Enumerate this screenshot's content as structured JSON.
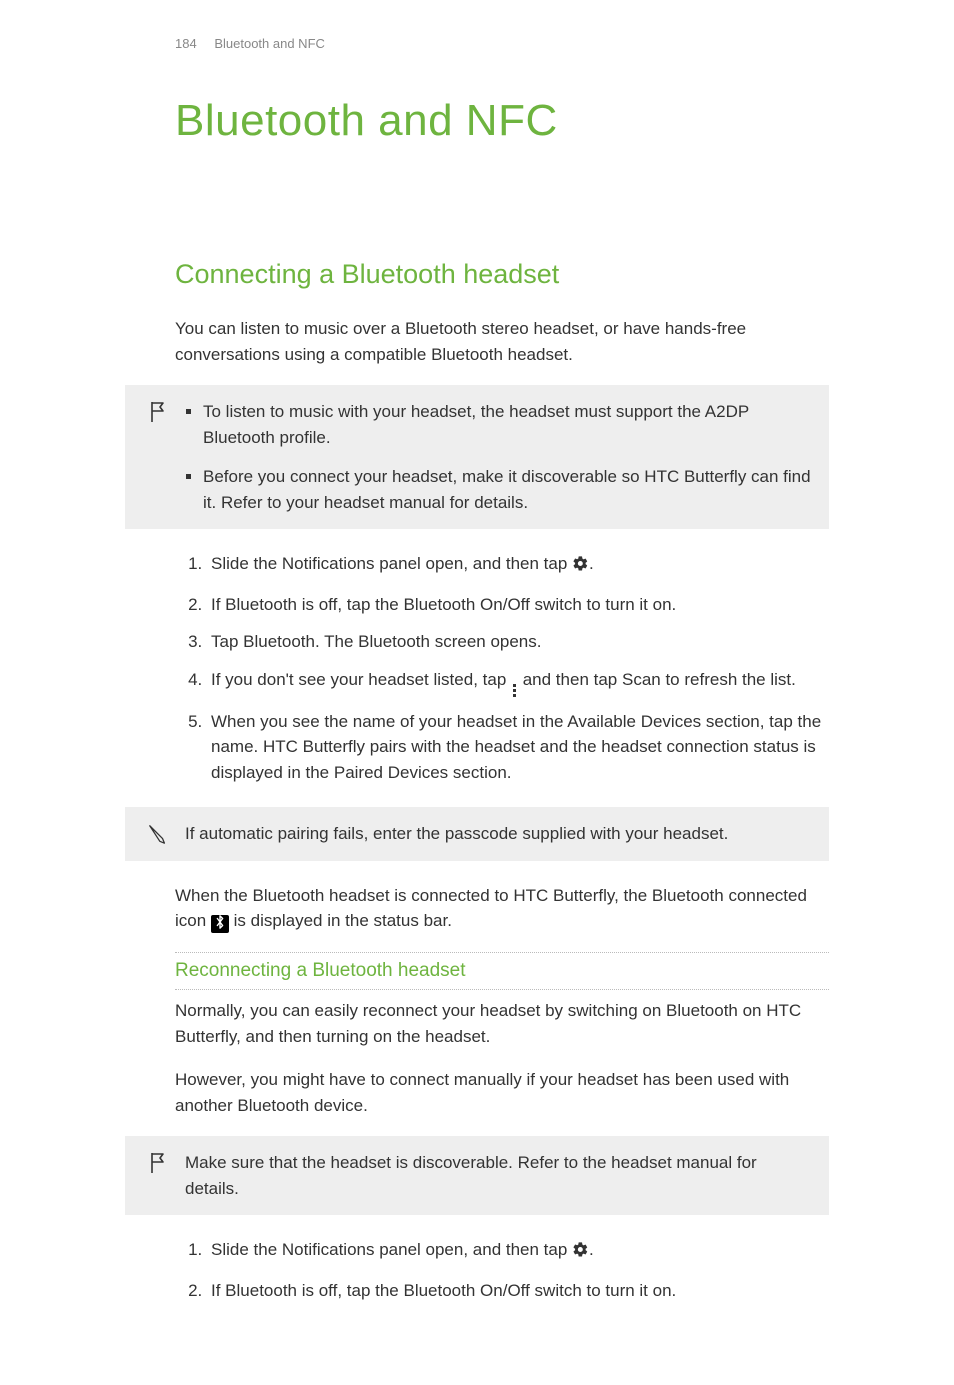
{
  "header": {
    "page_number": "184",
    "running_title": "Bluetooth and NFC"
  },
  "chapter_title": "Bluetooth and NFC",
  "section1": {
    "title": "Connecting a Bluetooth headset",
    "intro": "You can listen to music over a Bluetooth stereo headset, or have hands-free conversations using a compatible Bluetooth headset.",
    "req_note": {
      "items": [
        "To listen to music with your headset, the headset must support the A2DP Bluetooth profile.",
        "Before you connect your headset, make it discoverable so HTC Butterfly can find it. Refer to your headset manual for details."
      ]
    },
    "steps": {
      "s1a": "Slide the Notifications panel open, and then tap ",
      "s1b": ".",
      "s2a": "If Bluetooth is off, tap the Bluetooth ",
      "s2_onoff": "On/Off",
      "s2b": " switch to turn it on.",
      "s3a": "Tap ",
      "s3_bt": "Bluetooth",
      "s3b": ". The Bluetooth screen opens.",
      "s4a": "If you don't see your headset listed, tap ",
      "s4b": " and then tap ",
      "s4_scan": "Scan",
      "s4c": " to refresh the list.",
      "s5": "When you see the name of your headset in the Available Devices section, tap the name. HTC Butterfly pairs with the headset and the headset connection status is displayed in the Paired Devices section."
    },
    "tip_note": "If automatic pairing fails, enter the passcode supplied with your headset.",
    "after_a": "When the Bluetooth headset is connected to HTC Butterfly, the Bluetooth connected icon ",
    "after_b": " is displayed in the status bar."
  },
  "section2": {
    "title": "Reconnecting a Bluetooth headset",
    "p1": "Normally, you can easily reconnect your headset by switching on Bluetooth on HTC Butterfly, and then turning on the headset.",
    "p2": "However, you might have to connect manually if your headset has been used with another Bluetooth device.",
    "req_note": "Make sure that the headset is discoverable. Refer to the headset manual for details.",
    "steps": {
      "s1a": "Slide the Notifications panel open, and then tap ",
      "s1b": ".",
      "s2a": "If Bluetooth is off, tap the Bluetooth ",
      "s2_onoff": "On/Off",
      "s2b": " switch to turn it on."
    }
  },
  "icons": {
    "bt_glyph": "࿆"
  }
}
